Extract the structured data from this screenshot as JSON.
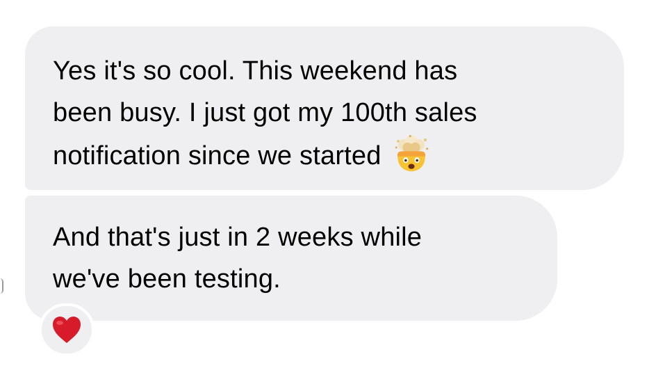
{
  "messages": [
    {
      "lines": [
        "Yes it's so cool. This weekend has",
        "been busy. I just got my 100th sales",
        "notification since we started"
      ],
      "emoji": "exploding-head-icon"
    },
    {
      "lines": [
        "And that's just in 2 weeks while",
        "we've been testing."
      ]
    }
  ],
  "reaction": {
    "emoji": "red-heart-icon",
    "color": "#d81b2a"
  },
  "colors": {
    "bubble": "#efeff1",
    "text": "#000000",
    "background": "#ffffff"
  }
}
